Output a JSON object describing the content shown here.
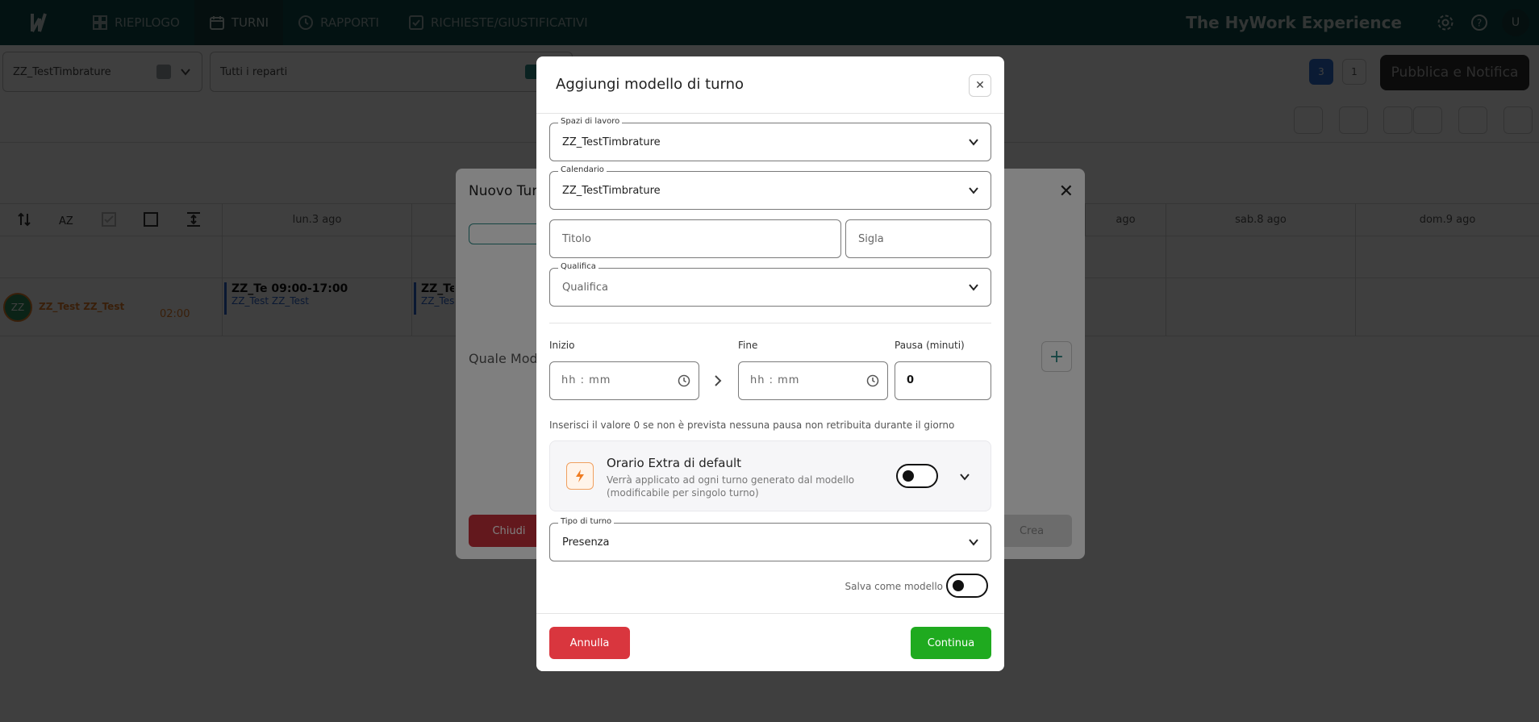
{
  "nav": {
    "tabs": [
      {
        "label": "RIEPILOGO",
        "icon": "dashboard-icon"
      },
      {
        "label": "TURNI",
        "icon": "calendar-icon"
      },
      {
        "label": "RAPPORTI",
        "icon": "clock-icon"
      },
      {
        "label": "RICHIESTE/GIUSTIFICATIVI",
        "icon": "checkbox-icon"
      }
    ],
    "brand": "The HyWork Experience",
    "user_initial": "U"
  },
  "filters": {
    "workspace": "ZZ_TestTimbrature",
    "departments": "Tutti i reparti",
    "count_a": "3",
    "count_b": "1",
    "publish": "Pubblica e Notifica"
  },
  "grid": {
    "days": [
      "lun.3 ago",
      "ago",
      "sab.8 ago",
      "dom.9 ago"
    ],
    "employee": {
      "initials": "ZZ",
      "name": "ZZ_Test ZZ_Test",
      "hours": "02:00"
    },
    "shifts": [
      {
        "title": "ZZ_Te 09:00-17:00",
        "sub": "ZZ_Test ZZ_Test"
      },
      {
        "title": "ZZ_Te",
        "sub": "ZZ_Tes"
      }
    ]
  },
  "bg_modal": {
    "title": "Nuovo Turno",
    "question": "Quale Mode",
    "close_label": "Chiudi",
    "create_label": "Crea"
  },
  "dialog": {
    "title": "Aggiungi modello di turno",
    "workspace": {
      "label": "Spazi di lavoro",
      "value": "ZZ_TestTimbrature"
    },
    "calendar": {
      "label": "Calendario",
      "value": "ZZ_TestTimbrature"
    },
    "title_field": {
      "placeholder": "Titolo"
    },
    "code_field": {
      "placeholder": "Sigla"
    },
    "qualification": {
      "label": "Qualifica",
      "placeholder": "Qualifica"
    },
    "start": {
      "label": "Inizio",
      "placeholder": "hh : mm"
    },
    "end": {
      "label": "Fine",
      "placeholder": "hh : mm"
    },
    "pause": {
      "label": "Pausa (minuti)",
      "value": "0"
    },
    "pause_hint": "Inserisci il valore 0 se non è prevista nessuna pausa non retribuita durante il giorno",
    "extra": {
      "title": "Orario Extra di default",
      "description": "Verrà applicato ad ogni turno generato dal modello (modificabile per singolo turno)",
      "enabled": false
    },
    "shift_type": {
      "label": "Tipo di turno",
      "value": "Presenza"
    },
    "save_as_model": {
      "label": "Salva come modello",
      "enabled": false
    },
    "cancel_label": "Annulla",
    "continue_label": "Continua"
  },
  "colors": {
    "topbar": "#0e4a48",
    "annulla": "#d9363e",
    "continua": "#1faa1f",
    "bolt": "#ef7c22"
  }
}
